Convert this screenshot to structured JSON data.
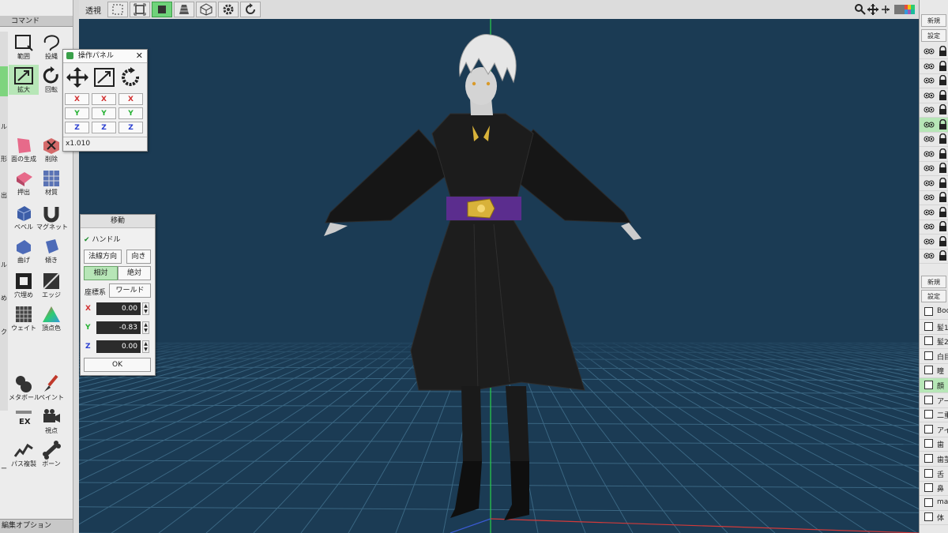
{
  "left_panel": {
    "title": "コマンド",
    "bottom_label": "編集オプション",
    "commands": [
      {
        "label": "範囲",
        "key": "S"
      },
      {
        "label": "投縄",
        "key": "G"
      },
      {
        "label": "拡大",
        "key": "C"
      },
      {
        "label": "回転",
        "key": "R"
      },
      {
        "label": "面の生成",
        "key": "P"
      },
      {
        "label": "削除",
        "key": "X"
      },
      {
        "label": "押出",
        "key": "E"
      },
      {
        "label": "材質",
        "key": "M"
      },
      {
        "label": "ベベル",
        "key": "V"
      },
      {
        "label": "マグネット",
        "key": "B"
      },
      {
        "label": "曲げ",
        "key": ""
      },
      {
        "label": "傾き",
        "key": ""
      },
      {
        "label": "穴埋め",
        "key": "F"
      },
      {
        "label": "エッジ",
        "key": "W"
      },
      {
        "label": "ウェイト",
        "key": ""
      },
      {
        "label": "頂点色",
        "key": ""
      },
      {
        "label": "メタボール",
        "key": ""
      },
      {
        "label": "ペイント",
        "key": ""
      },
      {
        "label": "",
        "key": ""
      },
      {
        "label": "視点",
        "key": ""
      },
      {
        "label": "パス複製",
        "key": ""
      },
      {
        "label": "ボーン",
        "key": ""
      }
    ],
    "partial_labels": [
      "形",
      "出",
      "ル",
      "ル",
      "め",
      "ク",
      "ー"
    ]
  },
  "toolbar": {
    "perspective_label": "透視",
    "icons": [
      "select-rect-icon",
      "frame-icon",
      "solid-view-icon",
      "pyramid-icon",
      "cube-icon",
      "gear-icon",
      "refresh-icon"
    ],
    "nav_icons": [
      "zoom-icon",
      "move-icon",
      "rotate-view-icon",
      "color-palette-icon"
    ]
  },
  "operation_panel": {
    "title": "操作パネル",
    "axes": [
      "X",
      "Y",
      "Z"
    ],
    "scale_text": "x1.010"
  },
  "move_panel": {
    "title": "移動",
    "handle_label": "ハンドル",
    "normal_dir_label": "法線方向",
    "direction_label": "向き",
    "relative_label": "相対",
    "absolute_label": "絶対",
    "coord_label": "座標系",
    "world_label": "ワールド",
    "x_label": "X",
    "x_value": "0.00",
    "y_label": "Y",
    "y_value": "-0.83",
    "z_label": "Z",
    "z_value": "0.00",
    "ok_label": "OK"
  },
  "right_panel": {
    "top_new": "新規",
    "top_settings": "設定",
    "bottom_new": "新規",
    "bottom_settings": "設定",
    "objects": [
      "Bod",
      "髪1",
      "髪2",
      "白目",
      "瞳",
      "顔",
      "アー",
      "二重",
      "アイ",
      "歯",
      "歯茎",
      "舌",
      "鼻",
      "mat",
      "体"
    ]
  },
  "colors": {
    "viewport_bg": "#1b3b54",
    "active_green": "#6fd37a",
    "selected_row": "#b7e6b7",
    "belt_purple": "#5b2d8e",
    "gold": "#d8b23a"
  }
}
